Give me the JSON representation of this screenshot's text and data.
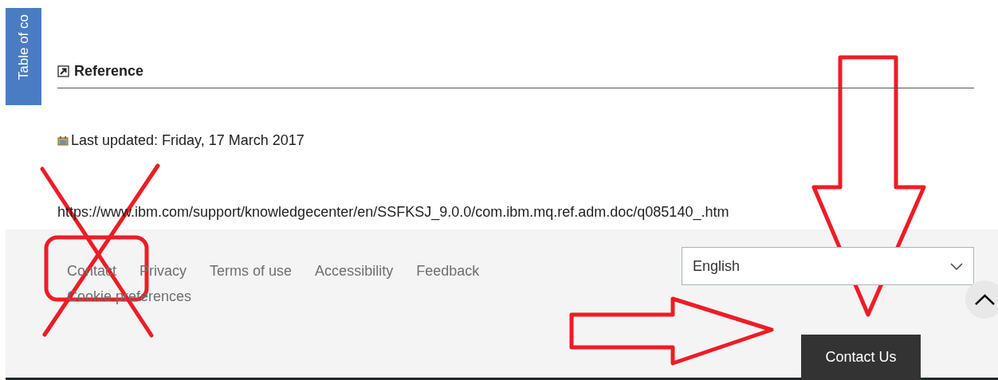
{
  "toc_tab": {
    "label": "Table of co"
  },
  "section": {
    "heading": "Reference"
  },
  "last_updated": "Last updated: Friday, 17 March 2017",
  "url": "https://www.ibm.com/support/knowledgecenter/en/SSFKSJ_9.0.0/com.ibm.mq.ref.adm.doc/q085140_.htm",
  "footer": {
    "links": [
      "Contact",
      "Privacy",
      "Terms of use",
      "Accessibility",
      "Feedback",
      "Cookie preferences"
    ],
    "language": {
      "value": "English"
    },
    "contact_button": "Contact Us"
  }
}
